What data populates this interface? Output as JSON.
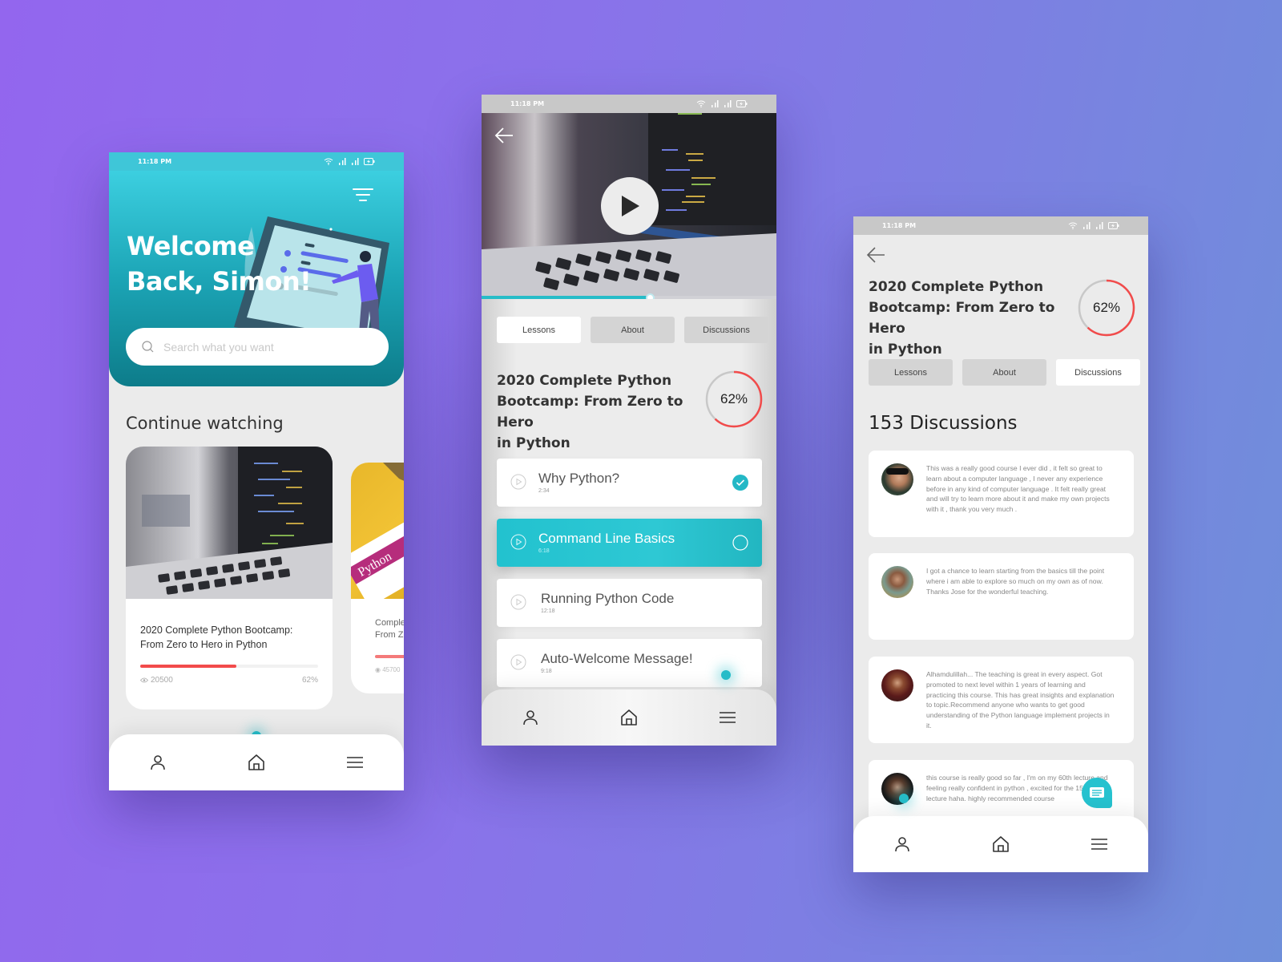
{
  "status_bar": {
    "time": "11:18 PM",
    "icons": [
      "wifi-icon",
      "signal-icon",
      "signal-icon",
      "battery-charging-icon"
    ]
  },
  "home_screen": {
    "greeting_line1": "Welcome",
    "greeting_line2": "Back, Simon!",
    "search": {
      "placeholder": "Search what you want",
      "value": ""
    },
    "section_title": "Continue watching",
    "courses": [
      {
        "title_line1": "2020 Complete Python Bootcamp:",
        "title_line2": "From Zero to Hero in Python",
        "views": "20500",
        "progress_label": "62%",
        "progress": 0.54
      },
      {
        "title_line1": "Comple",
        "title_line2": "From Z",
        "views": "45700"
      }
    ],
    "accent": "#26bcc8",
    "progress_color": "#f24b4b"
  },
  "bottom_nav": {
    "items": [
      {
        "name": "profile",
        "icon": "user-icon"
      },
      {
        "name": "home",
        "icon": "home-icon"
      },
      {
        "name": "menu",
        "icon": "hamburger-menu-icon"
      }
    ]
  },
  "lessons_screen": {
    "tabs": [
      "Lessons",
      "About",
      "Discussions"
    ],
    "active_tab": "Lessons",
    "course_title": "2020 Complete Python Bootcamp: From Zero to Hero in Python",
    "title_lines": [
      "2020 Complete Python",
      "Bootcamp: From Zero to Hero",
      "in Python"
    ],
    "progress_label": "62%",
    "progress": 0.62,
    "video_progress": 0.57,
    "lessons": [
      {
        "title": "Why Python?",
        "duration": "2:34",
        "status": "completed"
      },
      {
        "title": "Command Line Basics",
        "duration": "6:18",
        "status": "in-progress"
      },
      {
        "title": "Running Python Code",
        "duration": "12:18",
        "status": "none"
      },
      {
        "title": "Auto-Welcome Message!",
        "duration": "9:18",
        "status": "none"
      }
    ]
  },
  "discussions_screen": {
    "tabs": [
      "Lessons",
      "About",
      "Discussions"
    ],
    "active_tab": "Discussions",
    "title_lines": [
      "2020 Complete Python",
      "Bootcamp: From Zero to Hero",
      "in Python"
    ],
    "progress_label": "62%",
    "progress": 0.62,
    "count_label": "153 Discussions",
    "comments": [
      {
        "text": "This was a really good course I ever did , it felt so great to learn about a computer language , I never any experience before in any kind of computer language . It felt really great and will try to learn more about it and make my own projects with it , thank you very much ."
      },
      {
        "text": "I got a chance to learn starting from the basics till the point where i am able to explore so much on my own as of now. Thanks Jose for the wonderful teaching."
      },
      {
        "text": "Alhamdulillah... The teaching is great in every aspect. Got promoted to next level within 1 years of learning and practicing this course. This has great insights and explanation to topic.Recommend anyone who wants to get good understanding of the Python language implement projects in it."
      },
      {
        "text": "this course is really good so far , I'm on my 60th lecture and feeling really confident in python , excited for the 153rd lecture haha. highly recommended course"
      }
    ]
  }
}
